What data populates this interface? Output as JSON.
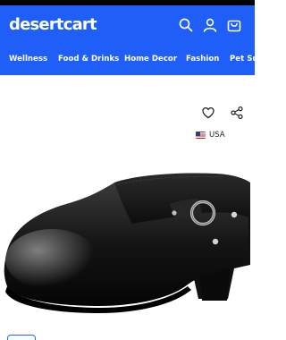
{
  "header": {
    "brand": "desertcart",
    "icons": [
      "search-icon",
      "user-icon",
      "cart-icon"
    ]
  },
  "nav": {
    "items": [
      {
        "label": "Wellness"
      },
      {
        "label": "Food & Drinks"
      },
      {
        "label": "Home Decor"
      },
      {
        "label": "Fashion"
      },
      {
        "label": "Pet Sup"
      }
    ]
  },
  "product": {
    "actions": [
      "heart-icon",
      "share-icon"
    ],
    "country_label": "USA",
    "flag_icon": "us-flag-icon"
  },
  "colors": {
    "brand_blue": "#1f5ef7",
    "text_dark": "#222222",
    "thumb_border": "#2a64f6"
  }
}
